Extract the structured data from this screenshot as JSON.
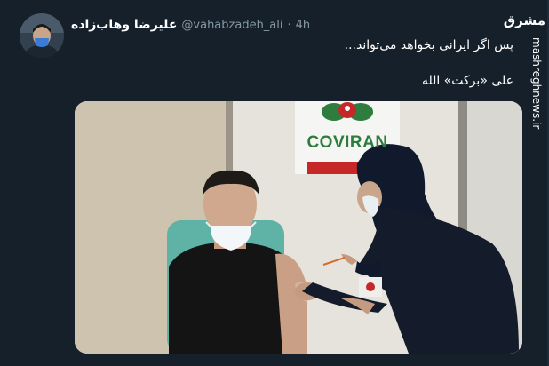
{
  "tweet": {
    "author_name": "علیرضا وهاب‌زاده",
    "handle": "@vahabzadeh_ali",
    "separator": "·",
    "time": "4h",
    "text_line1": "پس اگر ایرانی بخواهد می‌تواند...",
    "text_line2": "علی «برکت» الله"
  },
  "media": {
    "sign_text": "COVIRAN"
  },
  "watermark": {
    "logo": "مشرق",
    "site": "mashreghnews.ir"
  },
  "colors": {
    "background": "#15202b",
    "text": "#ffffff",
    "muted": "#8899a6",
    "brand_green": "#2e7d3f",
    "brand_red": "#c62828"
  }
}
